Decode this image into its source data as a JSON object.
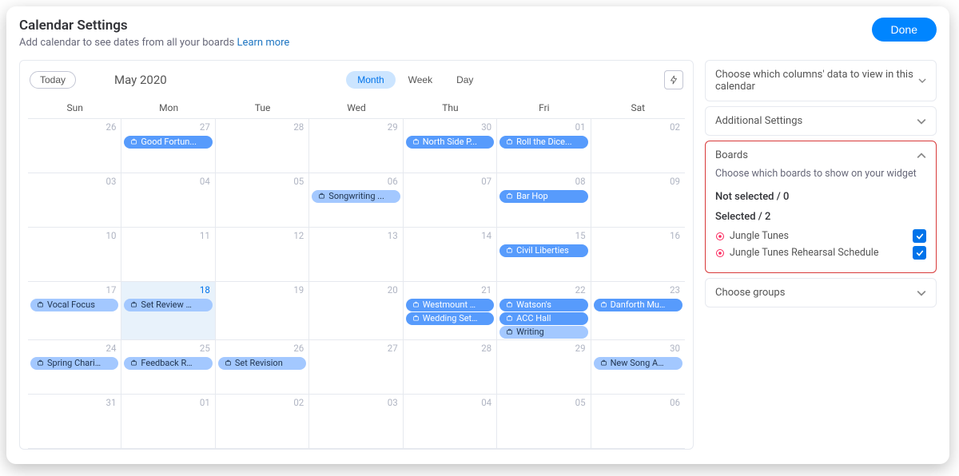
{
  "header": {
    "title": "Calendar Settings",
    "subtitle": "Add calendar to see dates from all your boards",
    "learn_more": "Learn more",
    "done": "Done"
  },
  "toolbar": {
    "today": "Today",
    "month_title": "May 2020",
    "views": {
      "month": "Month",
      "week": "Week",
      "day": "Day"
    },
    "active_view": "month"
  },
  "daynames": [
    "Sun",
    "Mon",
    "Tue",
    "Wed",
    "Thu",
    "Fri",
    "Sat"
  ],
  "weeks": [
    [
      {
        "num": "26"
      },
      {
        "num": "27",
        "events": [
          {
            "label": "Good Fortun...",
            "style": "blue"
          }
        ]
      },
      {
        "num": "28"
      },
      {
        "num": "29"
      },
      {
        "num": "30",
        "events": [
          {
            "label": "North Side P...",
            "style": "blue"
          }
        ]
      },
      {
        "num": "01",
        "events": [
          {
            "label": "Roll the Dice...",
            "style": "blue"
          }
        ]
      },
      {
        "num": "02"
      }
    ],
    [
      {
        "num": "03"
      },
      {
        "num": "04"
      },
      {
        "num": "05"
      },
      {
        "num": "06",
        "events": [
          {
            "label": "Songwriting ...",
            "style": "light"
          }
        ]
      },
      {
        "num": "07"
      },
      {
        "num": "08",
        "events": [
          {
            "label": "Bar Hop",
            "style": "blue"
          }
        ]
      },
      {
        "num": "09"
      }
    ],
    [
      {
        "num": "10"
      },
      {
        "num": "11"
      },
      {
        "num": "12"
      },
      {
        "num": "13"
      },
      {
        "num": "14"
      },
      {
        "num": "15",
        "events": [
          {
            "label": "Civil Liberties",
            "style": "blue"
          }
        ]
      },
      {
        "num": "16"
      }
    ],
    [
      {
        "num": "17",
        "events": [
          {
            "label": "Vocal Focus",
            "style": "light"
          }
        ]
      },
      {
        "num": "18",
        "today": true,
        "events": [
          {
            "label": "Set Review …",
            "style": "light"
          }
        ]
      },
      {
        "num": "19"
      },
      {
        "num": "20"
      },
      {
        "num": "21",
        "events": [
          {
            "label": "Westmount …",
            "style": "blue"
          },
          {
            "label": "Wedding Set…",
            "style": "blue"
          }
        ]
      },
      {
        "num": "22",
        "events": [
          {
            "label": "Watson's",
            "style": "blue"
          },
          {
            "label": "ACC Hall",
            "style": "blue"
          },
          {
            "label": "Writing",
            "style": "light"
          }
        ]
      },
      {
        "num": "23",
        "events": [
          {
            "label": "Danforth Mu…",
            "style": "blue"
          }
        ]
      }
    ],
    [
      {
        "num": "24",
        "events": [
          {
            "label": "Spring Chari…",
            "style": "light"
          }
        ]
      },
      {
        "num": "25",
        "events": [
          {
            "label": "Feedback R…",
            "style": "light"
          }
        ]
      },
      {
        "num": "26",
        "events": [
          {
            "label": "Set Revision",
            "style": "light"
          }
        ]
      },
      {
        "num": "27"
      },
      {
        "num": "28"
      },
      {
        "num": "29"
      },
      {
        "num": "30",
        "events": [
          {
            "label": "New Song A…",
            "style": "light"
          }
        ]
      }
    ],
    [
      {
        "num": "31"
      },
      {
        "num": "01"
      },
      {
        "num": "02"
      },
      {
        "num": "03"
      },
      {
        "num": "04"
      },
      {
        "num": "05"
      },
      {
        "num": "06"
      }
    ]
  ],
  "side": {
    "columns": "Choose which columns' data to view in this calendar",
    "additional": "Additional Settings",
    "boards": {
      "title": "Boards",
      "desc": "Choose which boards to show on your widget",
      "not_selected_label": "Not selected / 0",
      "selected_label": "Selected / 2",
      "items": [
        {
          "name": "Jungle Tunes",
          "checked": true
        },
        {
          "name": "Jungle Tunes Rehearsal Schedule",
          "checked": true
        }
      ]
    },
    "groups": "Choose groups"
  }
}
